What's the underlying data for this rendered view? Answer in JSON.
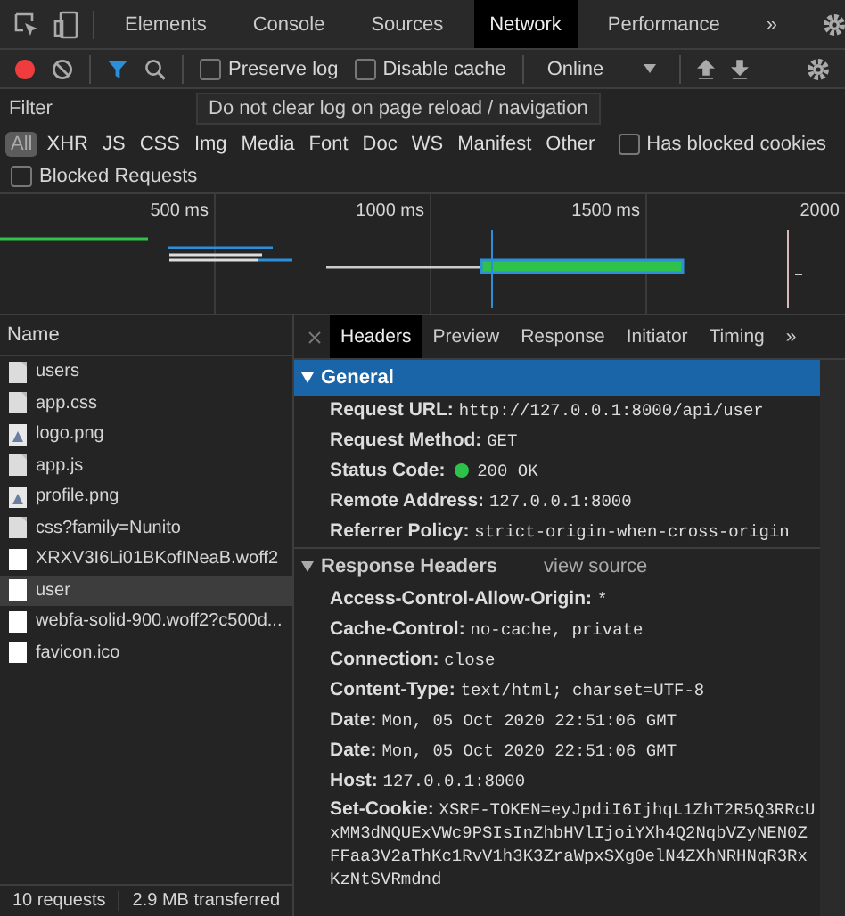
{
  "main_tabs": [
    {
      "label": "Elements",
      "selected": false
    },
    {
      "label": "Console",
      "selected": false
    },
    {
      "label": "Sources",
      "selected": false
    },
    {
      "label": "Network",
      "selected": true
    },
    {
      "label": "Performance",
      "selected": false
    }
  ],
  "more_tabs": "»",
  "toolbar": {
    "recording": true,
    "filter_active": true,
    "checkboxes": [
      {
        "label": "Preserve log",
        "checked": false
      },
      {
        "label": "Disable cache",
        "checked": false
      }
    ],
    "throttle": "Online"
  },
  "filter": {
    "placeholder": "Filter",
    "tooltip": "Do not clear log on page reload / navigation"
  },
  "types": [
    {
      "label": "All",
      "selected": true
    },
    {
      "label": "XHR",
      "selected": false
    },
    {
      "label": "JS",
      "selected": false
    },
    {
      "label": "CSS",
      "selected": false
    },
    {
      "label": "Img",
      "selected": false
    },
    {
      "label": "Media",
      "selected": false
    },
    {
      "label": "Font",
      "selected": false
    },
    {
      "label": "Doc",
      "selected": false
    },
    {
      "label": "WS",
      "selected": false
    },
    {
      "label": "Manifest",
      "selected": false
    },
    {
      "label": "Other",
      "selected": false
    }
  ],
  "extra_filters": [
    {
      "label": "Has blocked cookies",
      "checked": false
    },
    {
      "label": "Blocked Requests",
      "checked": false
    }
  ],
  "timeline": {
    "ticks": [
      "500 ms",
      "1000 ms",
      "1500 ms",
      "2000"
    ]
  },
  "requests": {
    "column": "Name",
    "rows": [
      {
        "name": "users",
        "kind": "doc",
        "selected": false
      },
      {
        "name": "app.css",
        "kind": "doc",
        "selected": false
      },
      {
        "name": "logo.png",
        "kind": "image",
        "selected": false
      },
      {
        "name": "app.js",
        "kind": "doc",
        "selected": false
      },
      {
        "name": "profile.png",
        "kind": "image",
        "selected": false
      },
      {
        "name": "css?family=Nunito",
        "kind": "doc",
        "selected": false
      },
      {
        "name": "XRXV3I6Li01BKofINeaB.woff2",
        "kind": "font",
        "selected": false
      },
      {
        "name": "user",
        "kind": "font",
        "selected": true
      },
      {
        "name": "webfa-solid-900.woff2?c500d...",
        "kind": "font",
        "selected": false
      },
      {
        "name": "favicon.ico",
        "kind": "font",
        "selected": false
      }
    ],
    "summary": [
      "10 requests",
      "2.9 MB transferred"
    ]
  },
  "detail_tabs": [
    {
      "label": "Headers",
      "selected": true
    },
    {
      "label": "Preview",
      "selected": false
    },
    {
      "label": "Response",
      "selected": false
    },
    {
      "label": "Initiator",
      "selected": false
    },
    {
      "label": "Timing",
      "selected": false
    }
  ],
  "detail_more": "»",
  "sections": [
    {
      "title": "General",
      "expanded": true,
      "selected": true,
      "rows": [
        {
          "key": "Request URL:",
          "value": "http://127.0.0.1:8000/api/user"
        },
        {
          "key": "Request Method:",
          "value": "GET"
        },
        {
          "key": "Status Code:",
          "value": "200 OK",
          "color": "#2fc24a"
        },
        {
          "key": "Remote Address:",
          "value": "127.0.0.1:8000"
        },
        {
          "key": "Referrer Policy:",
          "value": "strict-origin-when-cross-origin"
        }
      ]
    },
    {
      "title": "Response Headers",
      "link": "view source",
      "expanded": true,
      "selected": false,
      "rows": [
        {
          "key": "Access-Control-Allow-Origin:",
          "value": "*"
        },
        {
          "key": "Cache-Control:",
          "value": "no-cache, private"
        },
        {
          "key": "Connection:",
          "value": "close"
        },
        {
          "key": "Content-Type:",
          "value": "text/html; charset=UTF-8"
        },
        {
          "key": "Date:",
          "value": "Mon, 05 Oct 2020 22:51:06 GMT"
        },
        {
          "key": "Date:",
          "value": "Mon, 05 Oct 2020 22:51:06 GMT"
        },
        {
          "key": "Host:",
          "value": "127.0.0.1:8000"
        },
        {
          "key": "Set-Cookie:",
          "value": "XSRF-TOKEN=eyJpdiI6IjhqL1ZhT2R5Q3RRcUxMM3dNQUExVWc9PSIsInZhbHVlIjoiYXh4Q2NqbVZyNEN0ZFFaa3V2aThKc1RvV1h3K3ZraWpxSXg0elN4ZXhNRHNqR3RxKzNtSVRmdnd"
        }
      ]
    }
  ]
}
